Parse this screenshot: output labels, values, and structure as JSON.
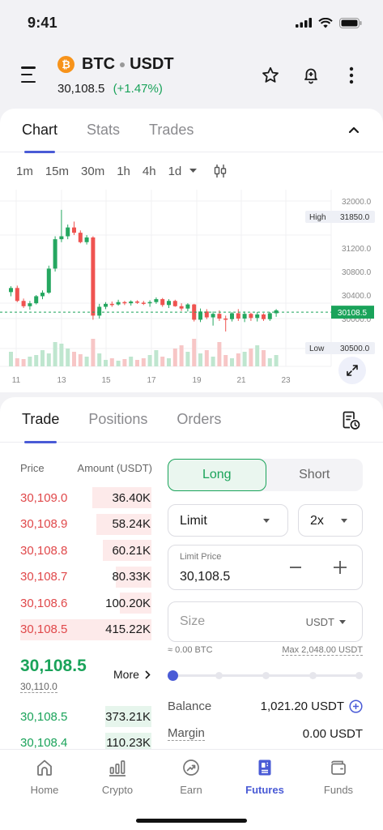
{
  "status": {
    "time": "9:41"
  },
  "header": {
    "coin_symbol": "₿",
    "base": "BTC",
    "quote": "USDT",
    "last_price": "30,108.5",
    "change": "(+1.47%)"
  },
  "chart_tabs": [
    "Chart",
    "Stats",
    "Trades"
  ],
  "timeframes": [
    "1m",
    "15m",
    "30m",
    "1h",
    "4h",
    "1d"
  ],
  "chart_data": {
    "type": "candlestick",
    "price_ticks": [
      "32000.0",
      "31200.0",
      "30800.0",
      "30400.0",
      "30000.0"
    ],
    "date_ticks": [
      "11",
      "13",
      "15",
      "17",
      "19",
      "21",
      "23"
    ],
    "high": {
      "label": "High",
      "value": "31850.0"
    },
    "low": {
      "label": "Low",
      "value": "30500.0"
    },
    "current": "30108.5",
    "colors": {
      "up": "#25a760",
      "down": "#ef5350",
      "current_line": "#1aa35a"
    }
  },
  "trade_tabs": [
    "Trade",
    "Positions",
    "Orders"
  ],
  "orderbook": {
    "price_header": "Price",
    "amount_header": "Amount (USDT)",
    "asks": [
      {
        "price": "30,109.0",
        "amount": "36.40K",
        "depth": 0.45
      },
      {
        "price": "30,108.9",
        "amount": "58.24K",
        "depth": 0.42
      },
      {
        "price": "30,108.8",
        "amount": "60.21K",
        "depth": 0.37
      },
      {
        "price": "30,108.7",
        "amount": "80.33K",
        "depth": 0.27
      },
      {
        "price": "30,108.6",
        "amount": "100.20K",
        "depth": 0.24
      },
      {
        "price": "30,108.5",
        "amount": "415.22K",
        "depth": 1.0
      }
    ],
    "mid_price": "30,108.5",
    "mark_price": "30,110.0",
    "more_label": "More",
    "bids": [
      {
        "price": "30,108.5",
        "amount": "373.21K",
        "depth": 0.35
      },
      {
        "price": "30,108.4",
        "amount": "110.23K",
        "depth": 0.35
      }
    ]
  },
  "order_form": {
    "long_label": "Long",
    "short_label": "Short",
    "order_type": "Limit",
    "leverage": "2x",
    "limit_price_label": "Limit Price",
    "limit_price": "30,108.5",
    "size_placeholder": "Size",
    "size_unit": "USDT",
    "size_hint": "≈ 0.00 BTC",
    "max_label": "Max 2,048.00 USDT",
    "slider_fraction": 0,
    "balance_label": "Balance",
    "balance_value": "1,021.20 USDT",
    "margin_label": "Margin",
    "margin_value": "0.00 USDT"
  },
  "bottom_nav": [
    {
      "label": "Home",
      "icon": "home-icon"
    },
    {
      "label": "Crypto",
      "icon": "bar-chart-icon"
    },
    {
      "label": "Earn",
      "icon": "earn-icon"
    },
    {
      "label": "Futures",
      "icon": "futures-icon",
      "active": true
    },
    {
      "label": "Funds",
      "icon": "wallet-icon"
    }
  ]
}
